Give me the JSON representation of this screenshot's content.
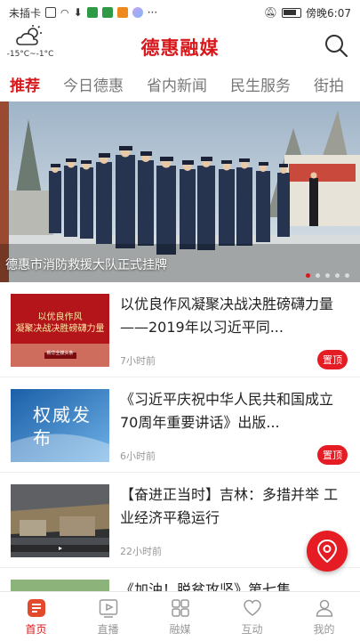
{
  "status_bar": {
    "left_text": "未插卡",
    "time": "傍晚6:07"
  },
  "header": {
    "title": "德惠融媒",
    "weather_temp": "-15°C~-1°C"
  },
  "tabs": [
    {
      "label": "推荐",
      "active": true
    },
    {
      "label": "今日德惠"
    },
    {
      "label": "省内新闻"
    },
    {
      "label": "民生服务"
    },
    {
      "label": "街拍"
    }
  ],
  "hero": {
    "caption": "德惠市消防救援大队正式挂牌",
    "dot_count": 5,
    "active_dot": 0
  },
  "news": [
    {
      "title": "以优良作风凝聚决战决胜磅礴力量——2019年以习近平同...",
      "time": "7小时前",
      "badge": "置顶",
      "thumb_text": "以优良作风\n凝聚决战决胜磅礴力量",
      "thumb_sub": "新华全媒头条"
    },
    {
      "title": "《习近平庆祝中华人民共和国成立70周年重要讲话》出版...",
      "time": "6小时前",
      "badge": "置顶",
      "thumb_text": "权威发布"
    },
    {
      "title": "【奋进正当时】吉林：多措并举 工业经济平稳运行",
      "time": "22小时前",
      "badge": ""
    },
    {
      "title": "《加油！脱贫攻坚》第七集",
      "time": "",
      "badge": ""
    }
  ],
  "bottom_nav": [
    {
      "label": "首页",
      "icon": "home-icon",
      "active": true
    },
    {
      "label": "直播",
      "icon": "live-icon"
    },
    {
      "label": "融媒",
      "icon": "media-icon"
    },
    {
      "label": "互动",
      "icon": "heart-icon"
    },
    {
      "label": "我的",
      "icon": "profile-icon"
    }
  ],
  "colors": {
    "accent": "#d7191d",
    "badge": "#e51c23"
  }
}
